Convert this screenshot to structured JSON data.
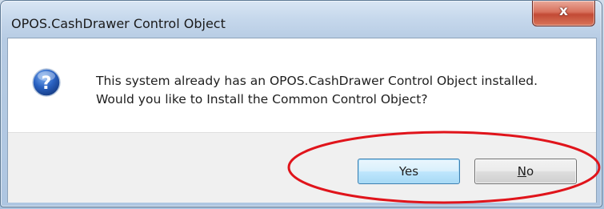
{
  "window": {
    "title": "OPOS.CashDrawer Control Object",
    "close_glyph": "x"
  },
  "dialog": {
    "icon": "question-icon",
    "message_line1": "This system already has an OPOS.CashDrawer Control Object installed.",
    "message_line2": "Would you like to Install the Common Control Object?"
  },
  "buttons": {
    "yes_label": "Yes",
    "no_mnemonic": "N",
    "no_rest": "o"
  },
  "colors": {
    "annotation": "#e0141b",
    "default_button_border": "#3c7fb1",
    "close_button": "#c24a35",
    "question_icon": "#1f4fa8"
  }
}
